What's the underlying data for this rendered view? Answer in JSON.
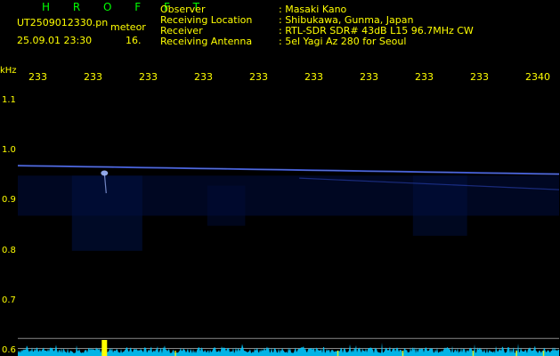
{
  "header": {
    "title": "H R O F F T",
    "filename": "UT2509012330.pn",
    "mode": "meteor",
    "datetime": "25.09.01 23:30",
    "count": "16."
  },
  "meta": {
    "labels": [
      "Observer",
      "Receiving Location",
      "Receiver",
      "Receiving Antenna"
    ],
    "values": [
      ": Masaki Kano",
      ": Shibukawa, Gunma, Japan",
      ": RTL-SDR SDR# 43dB L15 96.7MHz CW",
      ": 5el Yagi Az 280 for Seoul"
    ]
  },
  "axes": {
    "y_unit": "kHz",
    "time_ticks": [
      "233",
      "233",
      "233",
      "233",
      "233",
      "233",
      "233",
      "233",
      "233",
      "2340"
    ],
    "freq_ticks": [
      "1.1",
      "1.0",
      "0.9",
      "0.8",
      "0.7",
      "0.6"
    ]
  },
  "colors": {
    "background": "#000000",
    "text": "#ffff00",
    "title": "#00ff00",
    "signal": "#4060ff",
    "signal_bright": "#a0b8ff",
    "noise_floor": "#00c8ff",
    "peak": "#ffff00",
    "grid": "#888888"
  },
  "chart_data": {
    "type": "heatmap",
    "title": "H R O F F T",
    "xlabel": "",
    "ylabel": "kHz",
    "x_tick_labels": [
      "233",
      "233",
      "233",
      "233",
      "233",
      "233",
      "233",
      "233",
      "233",
      "2340"
    ],
    "y_ticks": [
      1.1,
      1.0,
      0.9,
      0.8,
      0.7,
      0.6
    ],
    "ylim": [
      0.59,
      1.13
    ],
    "xlim": [
      2330,
      2340
    ],
    "carrier": {
      "freq_start": 0.97,
      "freq_end": 0.953,
      "intensity": 0.75
    },
    "echo_line": {
      "freq_start": 0.945,
      "freq_end": 0.922,
      "intensity": 0.4
    },
    "meteor": {
      "time": 2331.6,
      "freq": 0.955
    },
    "peak_burst": {
      "time": 2331.6,
      "level": 0.9
    }
  }
}
